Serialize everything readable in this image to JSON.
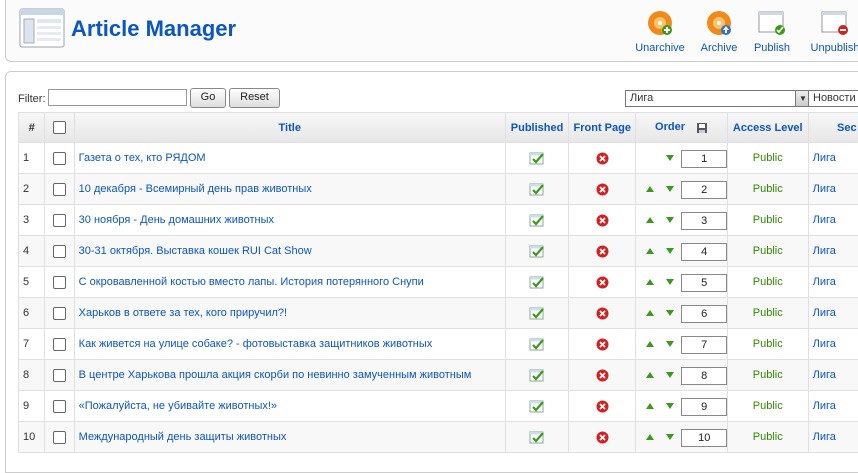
{
  "header": {
    "title": "Article Manager",
    "buttons": [
      {
        "label": "Unarchive",
        "icon": "unarchive-icon"
      },
      {
        "label": "Archive",
        "icon": "archive-icon"
      },
      {
        "label": "Publish",
        "icon": "publish-icon"
      },
      {
        "label": "Unpublish",
        "icon": "unpublish-icon"
      }
    ]
  },
  "filter": {
    "label": "Filter:",
    "value": "",
    "go_label": "Go",
    "reset_label": "Reset",
    "select1_value": "Лига",
    "select2_value": "Новости"
  },
  "table": {
    "headers": {
      "num": "#",
      "title": "Title",
      "published": "Published",
      "front_page": "Front Page",
      "order": "Order",
      "access": "Access Level",
      "section": "Sec"
    },
    "rows": [
      {
        "num": "1",
        "title": "Газета о тех, кто РЯДОМ",
        "order": "1",
        "access": "Public",
        "section": "Лига"
      },
      {
        "num": "2",
        "title": "10 декабря - Всемирный день прав животных",
        "order": "2",
        "access": "Public",
        "section": "Лига"
      },
      {
        "num": "3",
        "title": "30 ноября - День домашних животных",
        "order": "3",
        "access": "Public",
        "section": "Лига"
      },
      {
        "num": "4",
        "title": "30-31 октября. Выставка кошек RUI Cat Show",
        "order": "4",
        "access": "Public",
        "section": "Лига"
      },
      {
        "num": "5",
        "title": "С окровавленной костью вместо лапы. История потерянного Снупи",
        "order": "5",
        "access": "Public",
        "section": "Лига"
      },
      {
        "num": "6",
        "title": "Харьков в ответе за тех, кого приручил?!",
        "order": "6",
        "access": "Public",
        "section": "Лига"
      },
      {
        "num": "7",
        "title": "Как живется на улице собаке? - фотовыставка защитников животных",
        "order": "7",
        "access": "Public",
        "section": "Лига"
      },
      {
        "num": "8",
        "title": "В центре Харькова прошла акция скорби по невинно замученным животным",
        "order": "8",
        "access": "Public",
        "section": "Лига"
      },
      {
        "num": "9",
        "title": "«Пожалуйста, не убивайте животных!»",
        "order": "9",
        "access": "Public",
        "section": "Лига"
      },
      {
        "num": "10",
        "title": "Международный день защиты животных",
        "order": "10",
        "access": "Public",
        "section": "Лига"
      }
    ]
  },
  "colors": {
    "title_blue": "#0B55C4",
    "access_green": "#2e8b00",
    "unpublished_red": "#d42020"
  }
}
